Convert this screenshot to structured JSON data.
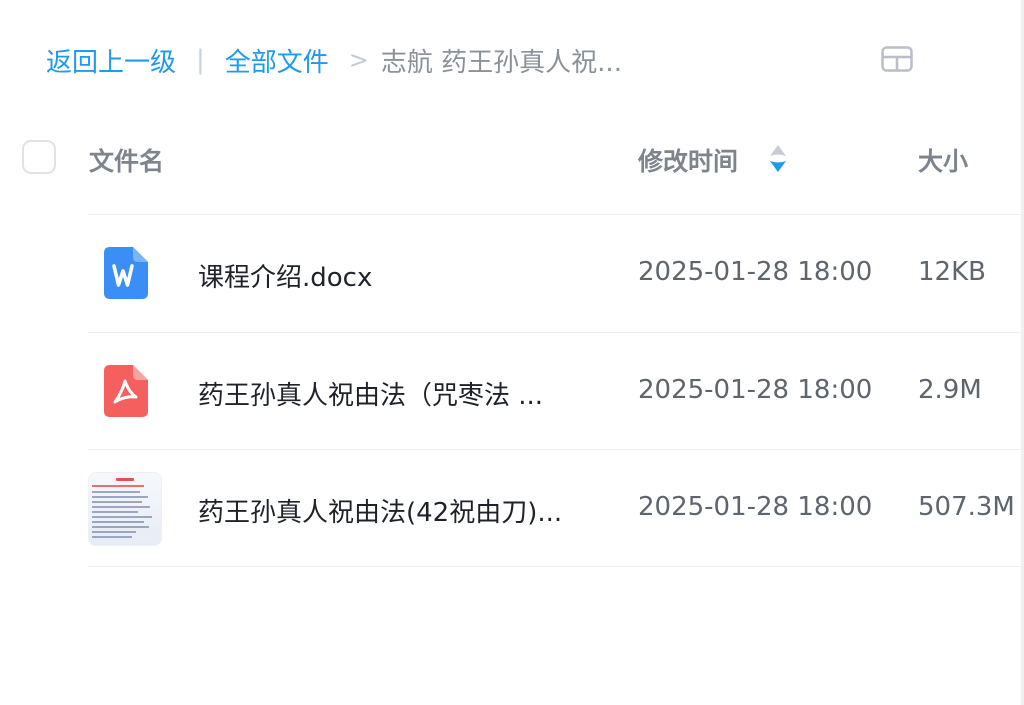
{
  "breadcrumb": {
    "back_label": "返回上一级",
    "separator": "|",
    "all_files_label": "全部文件",
    "arrow": ">",
    "current_label": "志航 药王孙真人祝..."
  },
  "view_toggle_icon": "grid-layout-icon",
  "table": {
    "columns": {
      "name": "文件名",
      "modified": "修改时间",
      "size": "大小"
    },
    "sort_icon": "sort-icon",
    "rows": [
      {
        "icon": "word-document-icon",
        "name": "课程介绍.docx",
        "modified": "2025-01-28 18:00",
        "size": "12KB"
      },
      {
        "icon": "pdf-document-icon",
        "name": "药王孙真人祝由法（咒枣法 ...",
        "modified": "2025-01-28 18:00",
        "size": "2.9M"
      },
      {
        "icon": "document-thumbnail",
        "name": "药王孙真人祝由法(42祝由刀)...",
        "modified": "2025-01-28 18:00",
        "size": "507.3M"
      }
    ]
  },
  "colors": {
    "link": "#1d9bf0",
    "word_icon": "#3a8ef6",
    "pdf_icon": "#f5605f",
    "sort_active": "#1d9bf0"
  }
}
